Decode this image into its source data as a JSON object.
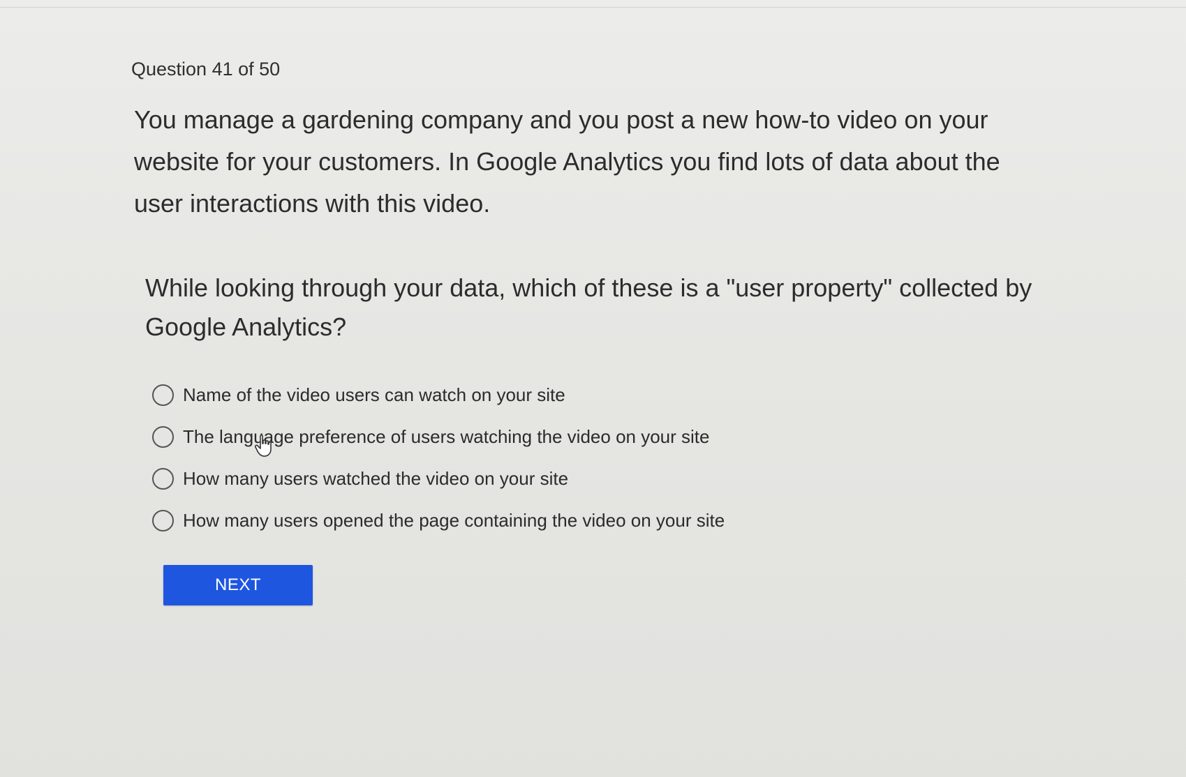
{
  "quiz": {
    "progress_label": "Question 41 of 50",
    "scenario": "You manage a gardening company and you post a new how-to video on your website for your customers. In Google Analytics you find lots of data about the user interactions with this video.",
    "question": "While looking through your data, which of these is a \"user property\" collected by Google Analytics?",
    "options": [
      {
        "label": "Name of the video users can watch on your site"
      },
      {
        "label": "The language preference of users watching the video on your site"
      },
      {
        "label": "How many users watched the video on your site"
      },
      {
        "label": "How many users opened the page containing the video on your site"
      }
    ],
    "next_label": "NEXT"
  },
  "theme": {
    "accent": "#1e56e0",
    "background": "#e6e6e3",
    "text": "#2c2c2c"
  },
  "icons": {
    "radio": "radio-unselected-icon",
    "cursor": "hand-pointer-icon"
  }
}
